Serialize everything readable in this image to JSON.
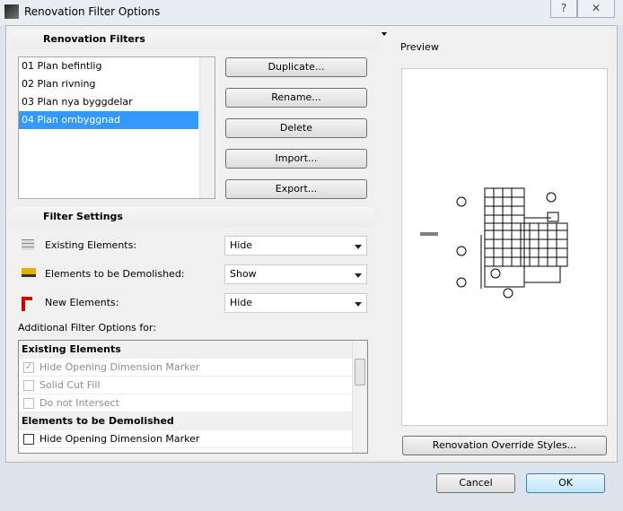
{
  "window": {
    "title": "Renovation Filter Options",
    "help": "?",
    "close": "✕"
  },
  "filters": {
    "heading": "Renovation Filters",
    "items": [
      "01 Plan befintlig",
      "02 Plan rivning",
      "03 Plan nya byggdelar",
      "04 Plan ombyggnad"
    ],
    "selected_index": 3,
    "buttons": {
      "duplicate": "Duplicate...",
      "rename": "Rename...",
      "delete": "Delete",
      "import": "Import...",
      "export": "Export..."
    }
  },
  "settings": {
    "heading": "Filter Settings",
    "rows": [
      {
        "label": "Existing Elements:",
        "value": "Hide",
        "icon": "brick-wall-icon"
      },
      {
        "label": "Elements to be Demolished:",
        "value": "Show",
        "icon": "bulldozer-icon"
      },
      {
        "label": "New Elements:",
        "value": "Hide",
        "icon": "crane-icon"
      }
    ]
  },
  "additional": {
    "label": "Additional Filter Options for:",
    "groups": [
      {
        "header": "Existing Elements",
        "options": [
          {
            "label": "Hide Opening Dimension Marker",
            "checked": true,
            "disabled": true
          },
          {
            "label": "Solid Cut Fill",
            "checked": false,
            "disabled": true
          },
          {
            "label": "Do not Intersect",
            "checked": false,
            "disabled": true
          }
        ]
      },
      {
        "header": "Elements to be Demolished",
        "options": [
          {
            "label": "Hide Opening Dimension Marker",
            "checked": false,
            "disabled": false
          }
        ]
      }
    ]
  },
  "preview": {
    "label": "Preview",
    "override_button": "Renovation Override Styles..."
  },
  "footer": {
    "cancel": "Cancel",
    "ok": "OK"
  }
}
